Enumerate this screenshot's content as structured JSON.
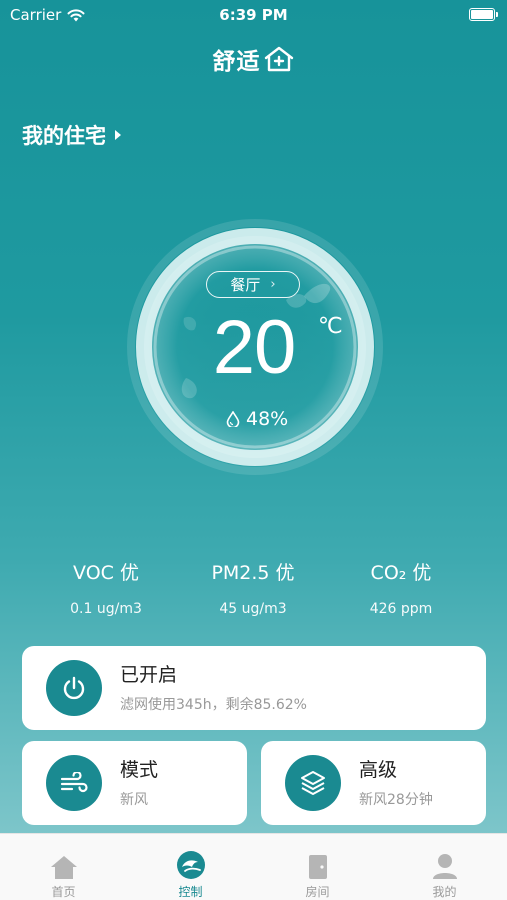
{
  "status_bar": {
    "carrier": "Carrier",
    "time": "6:39 PM"
  },
  "app": {
    "logo_text": "舒适"
  },
  "home": {
    "title": "我的住宅"
  },
  "room": {
    "name": "餐厅",
    "temperature": "20",
    "unit": "℃",
    "humidity": "48%"
  },
  "metrics": [
    {
      "name": "VOC 优",
      "value": "0.1 ug/m3"
    },
    {
      "name": "PM2.5 优",
      "value": "45 ug/m3"
    },
    {
      "name": "CO₂ 优",
      "value": "426 ppm"
    }
  ],
  "cards": {
    "power": {
      "title": "已开启",
      "subtitle": "滤网使用345h，剩余85.62%",
      "icon": "power-icon"
    },
    "mode": {
      "title": "模式",
      "subtitle": "新风",
      "icon": "wind-icon"
    },
    "advanced": {
      "title": "高级",
      "subtitle": "新风28分钟",
      "icon": "layers-icon"
    }
  },
  "tabs": [
    {
      "label": "首页",
      "icon": "home-icon",
      "active": false
    },
    {
      "label": "控制",
      "icon": "control-icon",
      "active": true
    },
    {
      "label": "房间",
      "icon": "door-icon",
      "active": false
    },
    {
      "label": "我的",
      "icon": "user-icon",
      "active": false
    }
  ],
  "colors": {
    "accent": "#1a8a91",
    "background_top": "#17939a",
    "inactive_tab": "#9a9a9a"
  }
}
